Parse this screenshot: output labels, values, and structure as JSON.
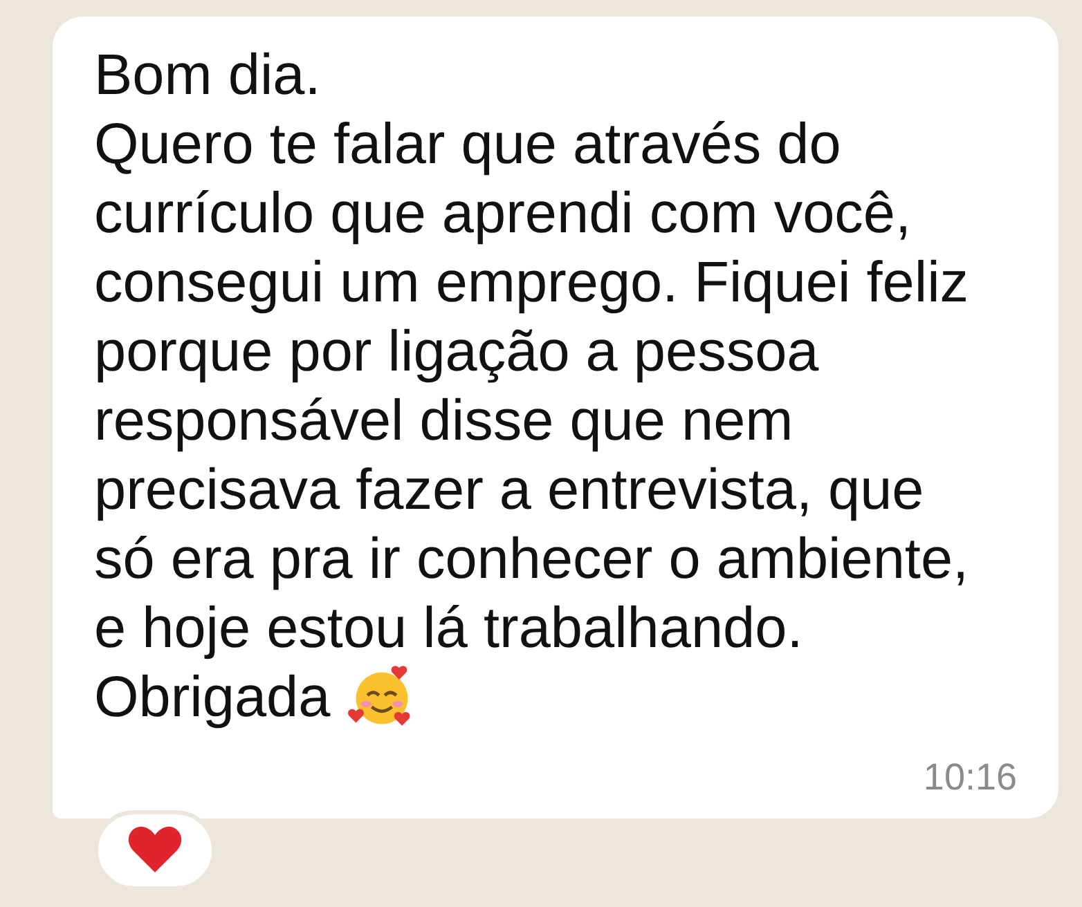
{
  "message": {
    "text": "Bom dia.\nQuero te falar que através do\ncurrículo que aprendi com você,\nconsegui um emprego. Fiquei feliz\nporque por ligação a pessoa\nresponsável disse que nem\nprecisava fazer a entrevista, que\nsó era pra ir conhecer o ambiente,\ne hoje estou lá trabalhando.",
    "closing": "Obrigada",
    "time": "10:16"
  },
  "reaction": {
    "kind": "heart"
  }
}
